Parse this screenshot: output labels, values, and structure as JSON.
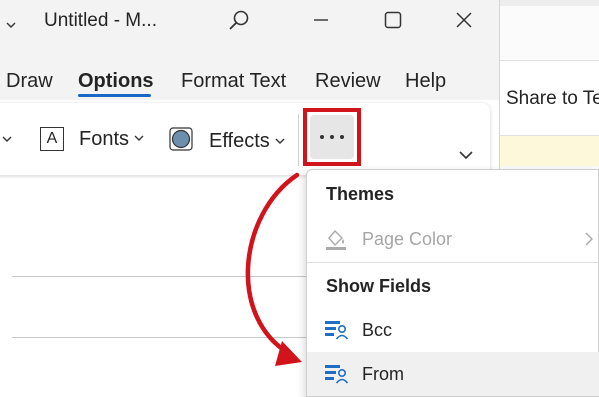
{
  "window": {
    "title": "Untitled  -  M..."
  },
  "tabs": [
    {
      "label": "Draw"
    },
    {
      "label": "Options"
    },
    {
      "label": "Format Text"
    },
    {
      "label": "Review"
    },
    {
      "label": "Help"
    }
  ],
  "ribbon": {
    "fonts_label": "Fonts",
    "effects_label": "Effects",
    "more_icon": "more-horizontal-icon"
  },
  "background_window": {
    "share_label": "Share to Te"
  },
  "menu": {
    "themes_heading": "Themes",
    "page_color_label": "Page Color",
    "show_fields_heading": "Show Fields",
    "bcc_label": "Bcc",
    "from_label": "From"
  },
  "colors": {
    "accent": "#1967c9",
    "highlight": "#d1131b",
    "arrow": "#d1131b"
  }
}
